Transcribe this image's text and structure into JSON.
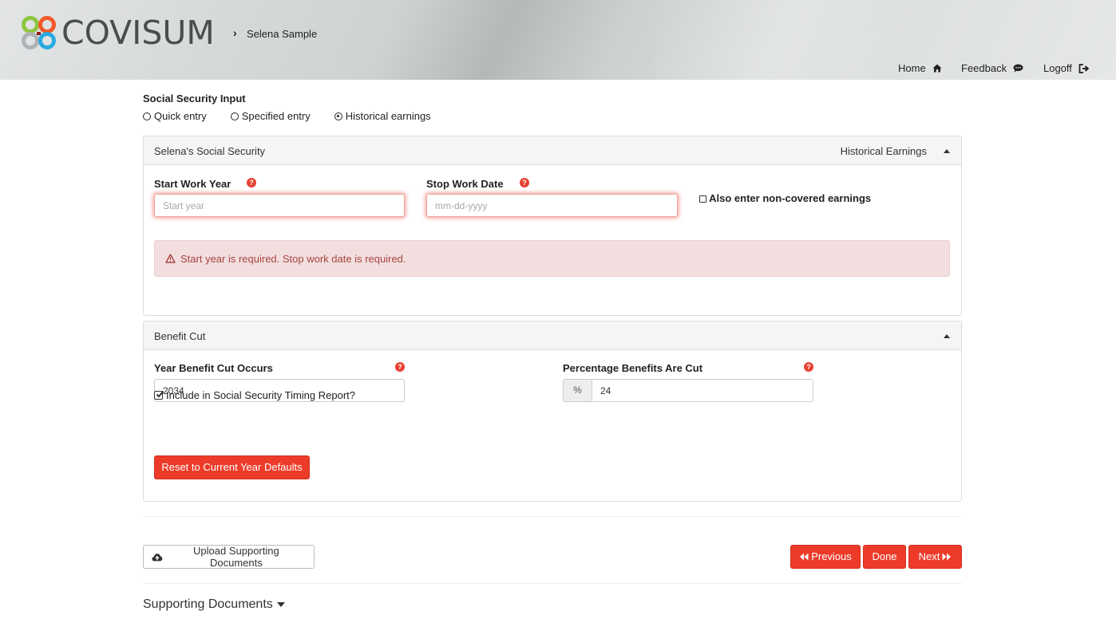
{
  "header": {
    "brand": "COVISUM",
    "breadcrumb_sep": "›",
    "client_name": "Selena Sample",
    "nav": {
      "home": "Home",
      "feedback": "Feedback",
      "logoff": "Logoff"
    }
  },
  "input_type": {
    "title": "Social Security Input",
    "options": [
      "Quick entry",
      "Specified entry",
      "Historical earnings"
    ],
    "selected": "Historical earnings"
  },
  "ss_panel": {
    "title": "Selena's Social Security",
    "mode_label": "Historical Earnings",
    "start_work_year": {
      "label": "Start Work Year",
      "value": "",
      "placeholder": "Start year"
    },
    "stop_work_date": {
      "label": "Stop Work Date",
      "value": "",
      "placeholder": "mm-dd-yyyy"
    },
    "non_covered_label": "Also enter non-covered earnings",
    "non_covered_checked": false,
    "error_message": "Start year is required. Stop work date is required."
  },
  "benefit_panel": {
    "title": "Benefit Cut",
    "year_label": "Year Benefit Cut Occurs",
    "year_value": "2034",
    "pct_label": "Percentage Benefits Are Cut",
    "pct_addon": "%",
    "pct_value": "24",
    "include_label": "Include in Social Security Timing Report?",
    "include_checked": true,
    "reset_button": "Reset to Current Year Defaults"
  },
  "footer": {
    "upload_button": "Upload Supporting Documents",
    "previous_button": "Previous",
    "done_button": "Done",
    "next_button": "Next",
    "supporting_docs_title": "Supporting Documents"
  },
  "colors": {
    "accent_red": "#ed3b2a",
    "error_bg": "#f2dede",
    "error_text": "#a94442"
  }
}
